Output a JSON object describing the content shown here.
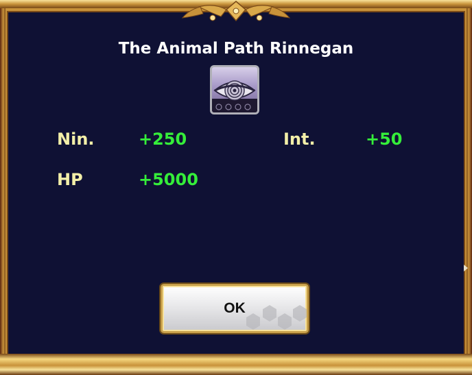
{
  "dialog": {
    "title": "The Animal Path Rinnegan",
    "icon": "rinnegan-eye-icon",
    "ok_label": "OK"
  },
  "stats": [
    {
      "label": "Nin.",
      "value": "+250"
    },
    {
      "label": "Int.",
      "value": "+50"
    },
    {
      "label": "HP",
      "value": "+5000"
    }
  ],
  "colors": {
    "panel_background": "#0f1134",
    "frame_gold": "#c8923a",
    "stat_label": "#f3efa8",
    "stat_value": "#35ee3a",
    "title_text": "#ffffff"
  }
}
